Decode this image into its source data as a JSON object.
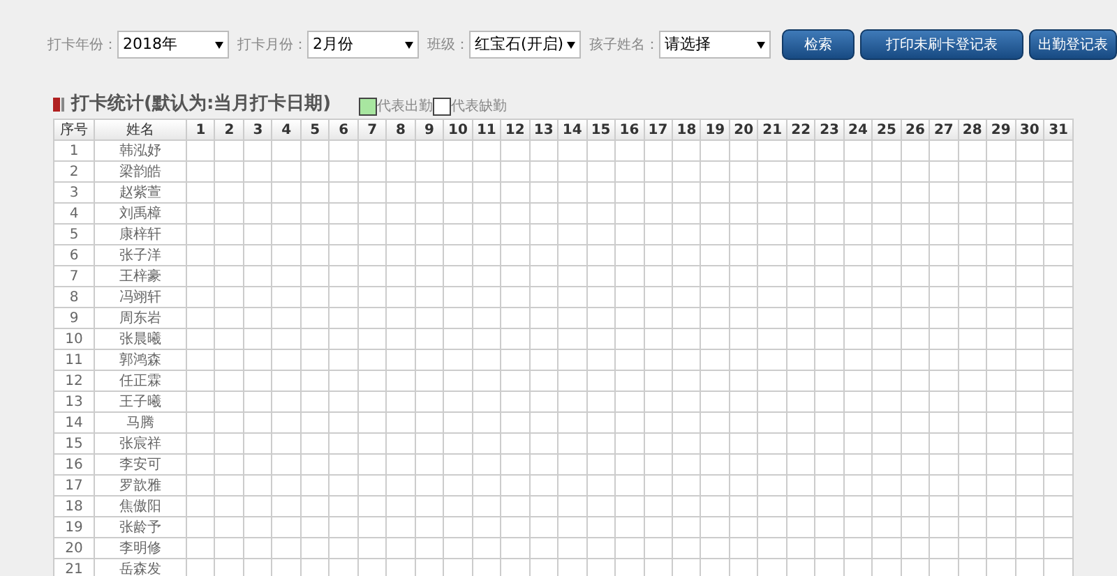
{
  "filters": [
    {
      "label": "打卡年份：",
      "value": "2018年"
    },
    {
      "label": "打卡月份：",
      "value": "2月份"
    },
    {
      "label": "班级：",
      "value": "红宝石(开启)"
    },
    {
      "label": "孩子姓名：",
      "value": "请选择"
    }
  ],
  "buttons": [
    "检索",
    "打印未刷卡登记表",
    "出勤登记表"
  ],
  "section_title": "打卡统计(默认为:当月打卡日期)",
  "legend": [
    {
      "label": "代表出勤",
      "color": "#a8e6a0"
    },
    {
      "label": "代表缺勤",
      "color": "#ffffff"
    }
  ],
  "table": {
    "columns": [
      "序号",
      "姓名",
      "1",
      "2",
      "3",
      "4",
      "5",
      "6",
      "7",
      "8",
      "9",
      "10",
      "11",
      "12",
      "13",
      "14",
      "15",
      "16",
      "17",
      "18",
      "19",
      "20",
      "21",
      "22",
      "23",
      "24",
      "25",
      "26",
      "27",
      "28",
      "29",
      "30",
      "31"
    ],
    "rows": [
      [
        "1",
        "韩泓妤"
      ],
      [
        "2",
        "梁韵皓"
      ],
      [
        "3",
        "赵紫萱"
      ],
      [
        "4",
        "刘禹樟"
      ],
      [
        "5",
        "康梓轩"
      ],
      [
        "6",
        "张子洋"
      ],
      [
        "7",
        "王梓豪"
      ],
      [
        "8",
        "冯翊轩"
      ],
      [
        "9",
        "周东岩"
      ],
      [
        "10",
        "张晨曦"
      ],
      [
        "11",
        "郭鸿森"
      ],
      [
        "12",
        "任正霖"
      ],
      [
        "13",
        "王子曦"
      ],
      [
        "14",
        "马腾"
      ],
      [
        "15",
        "张宸祥"
      ],
      [
        "16",
        "李安可"
      ],
      [
        "17",
        "罗歆雅"
      ],
      [
        "18",
        "焦傲阳"
      ],
      [
        "19",
        "张龄予"
      ],
      [
        "20",
        "李明修"
      ],
      [
        "21",
        "岳森发"
      ]
    ]
  }
}
